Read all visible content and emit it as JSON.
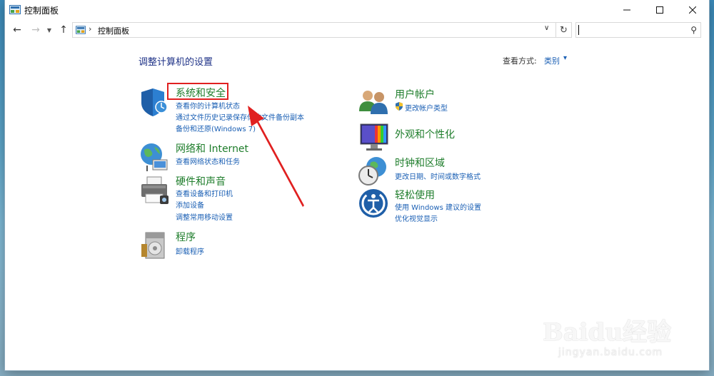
{
  "window": {
    "title": "控制面板"
  },
  "navbar": {
    "breadcrumb": "控制面板",
    "search_placeholder": ""
  },
  "header": {
    "title": "调整计算机的设置",
    "view_label": "查看方式:",
    "view_value": "类别"
  },
  "categories": [
    {
      "title": "系统和安全",
      "links": [
        "查看你的计算机状态",
        "通过文件历史记录保存你的文件备份副本",
        "备份和还原(Windows 7)"
      ]
    },
    {
      "title": "网络和 Internet",
      "links": [
        "查看网络状态和任务"
      ]
    },
    {
      "title": "硬件和声音",
      "links": [
        "查看设备和打印机",
        "添加设备",
        "调整常用移动设置"
      ]
    },
    {
      "title": "程序",
      "links": [
        "卸载程序"
      ]
    },
    {
      "title": "用户帐户",
      "links": [
        "更改帐户类型"
      ]
    },
    {
      "title": "外观和个性化",
      "links": []
    },
    {
      "title": "时钟和区域",
      "links": [
        "更改日期、时间或数字格式"
      ]
    },
    {
      "title": "轻松使用",
      "links": [
        "使用 Windows 建议的设置",
        "优化视觉显示"
      ]
    }
  ],
  "watermark": {
    "logo": "Baidu经验",
    "url": "jingyan.baidu.com"
  },
  "colors": {
    "category_title": "#1e7d2b",
    "link": "#1a5fb4",
    "page_title": "#1e3287",
    "annotation": "#e02020"
  },
  "icons": [
    "control-panel-icon",
    "back-arrow-icon",
    "forward-arrow-icon",
    "up-arrow-icon",
    "refresh-icon",
    "search-icon",
    "shield-icon",
    "globe-network-icon",
    "printer-icon",
    "programs-icon",
    "users-icon",
    "monitor-color-icon",
    "clock-globe-icon",
    "ease-of-access-icon",
    "uac-shield-icon"
  ]
}
